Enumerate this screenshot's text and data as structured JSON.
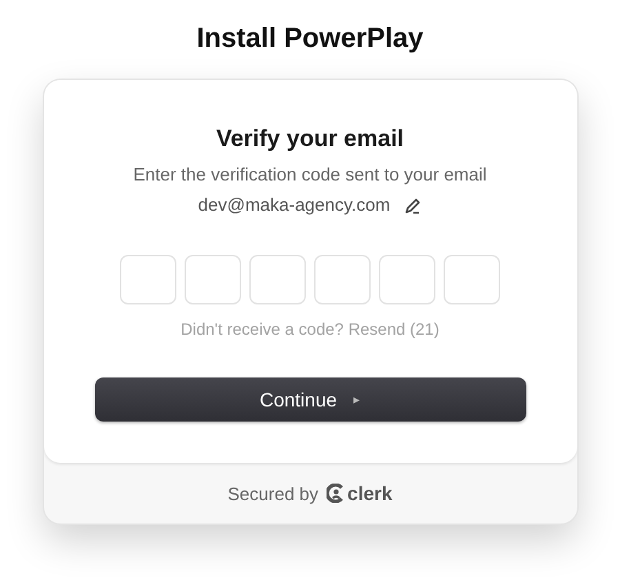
{
  "page_title": "Install PowerPlay",
  "card": {
    "title": "Verify your email",
    "subtitle": "Enter the verification code sent to your email",
    "email": "dev@maka-agency.com",
    "code_fields": [
      {
        "kind": "digit"
      },
      {
        "kind": "digit"
      },
      {
        "kind": "digit"
      },
      {
        "kind": "digit"
      },
      {
        "kind": "digit"
      },
      {
        "kind": "digit"
      }
    ],
    "resend": "Didn't receive a code? Resend (21)",
    "button": {
      "label": "Continue",
      "icon": "▸"
    }
  },
  "footer": {
    "label": "Secured by",
    "brand": "clerk"
  }
}
